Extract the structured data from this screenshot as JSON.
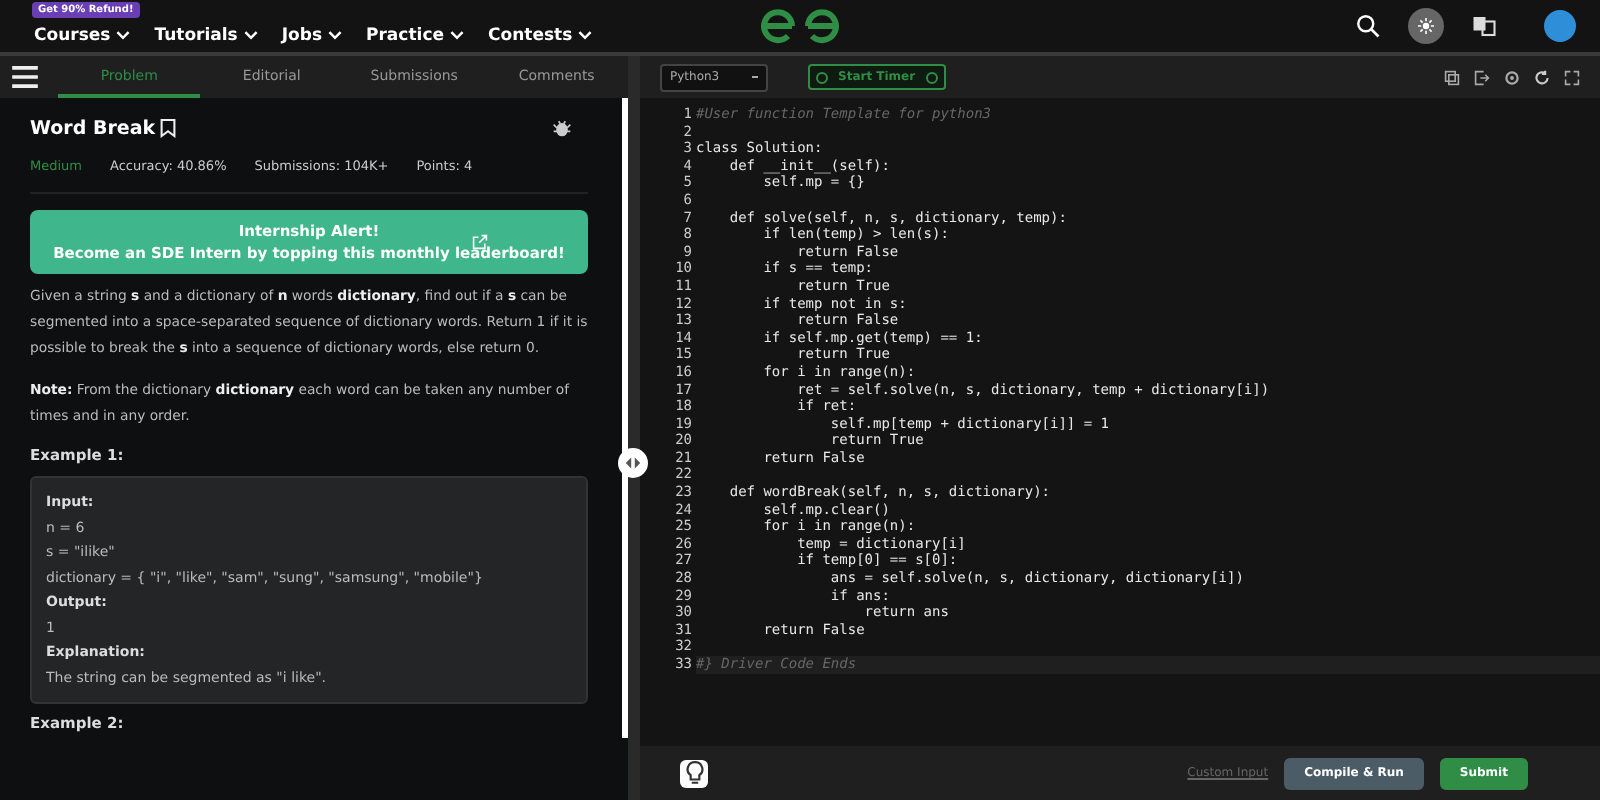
{
  "topnav": {
    "promo_badge": "Get 90% Refund!",
    "menus": [
      {
        "label": "Courses"
      },
      {
        "label": "Tutorials"
      },
      {
        "label": "Jobs"
      },
      {
        "label": "Practice"
      },
      {
        "label": "Contests"
      }
    ]
  },
  "left_tabs": [
    {
      "label": "Problem",
      "selected": true
    },
    {
      "label": "Editorial",
      "selected": false
    },
    {
      "label": "Submissions",
      "selected": false
    },
    {
      "label": "Comments",
      "selected": false
    }
  ],
  "problem": {
    "title": "Word Break",
    "difficulty": "Medium",
    "accuracy": "Accuracy: 40.86%",
    "submissions": "Submissions: 104K+",
    "points": "Points: 4",
    "banner": {
      "line1": "Internship Alert!",
      "line2": "Become an SDE Intern by topping this monthly leaderboard!"
    },
    "paragraphs": [
      "Given a string **s** and a dictionary of **n** words **dictionary**, find out if a **s** can be segmented into a space-separated sequence of dictionary words. Return 1 if it is possible to break the **s** into a sequence of dictionary words, else return 0.",
      "**Note:** From the dictionary **dictionary** each word can be taken any number of times and in any order."
    ],
    "example1": {
      "heading": "Example 1:",
      "lines": [
        {
          "kind": "label",
          "text": "Input:"
        },
        {
          "kind": "value",
          "text": "n = 6"
        },
        {
          "kind": "value",
          "text": "s = \"ilike\""
        },
        {
          "kind": "value",
          "text": "dictionary = { \"i\", \"like\", \"sam\", \"sung\", \"samsung\", \"mobile\"}"
        },
        {
          "kind": "label",
          "text": "Output:"
        },
        {
          "kind": "value",
          "text": "1"
        },
        {
          "kind": "label",
          "text": "Explanation:"
        },
        {
          "kind": "value",
          "text": "The string can be segmented as \"i like\"."
        }
      ]
    },
    "example2_heading": "Example 2:"
  },
  "editor": {
    "language": "Python3",
    "timer_button": "Start Timer",
    "lines": [
      {
        "kind": "comment",
        "text": "#User function Template for python3"
      },
      {
        "kind": "blank"
      },
      {
        "kind": "code",
        "text": "class Solution:"
      },
      {
        "kind": "code",
        "text": "    def __init__(self):"
      },
      {
        "kind": "code",
        "text": "        self.mp = {}"
      },
      {
        "kind": "blank"
      },
      {
        "kind": "code",
        "text": "    def solve(self, n, s, dictionary, temp):"
      },
      {
        "kind": "code",
        "text": "        if len(temp) > len(s):"
      },
      {
        "kind": "code",
        "text": "            return False"
      },
      {
        "kind": "code",
        "text": "        if s == temp:"
      },
      {
        "kind": "code",
        "text": "            return True"
      },
      {
        "kind": "code",
        "text": "        if temp not in s:"
      },
      {
        "kind": "code",
        "text": "            return False"
      },
      {
        "kind": "code",
        "text": "        if self.mp.get(temp) == 1:"
      },
      {
        "kind": "code",
        "text": "            return True"
      },
      {
        "kind": "code",
        "text": "        for i in range(n):"
      },
      {
        "kind": "code",
        "text": "            ret = self.solve(n, s, dictionary, temp + dictionary[i])"
      },
      {
        "kind": "code",
        "text": "            if ret:"
      },
      {
        "kind": "code",
        "text": "                self.mp[temp + dictionary[i]] = 1"
      },
      {
        "kind": "code",
        "text": "                return True"
      },
      {
        "kind": "code",
        "text": "        return False"
      },
      {
        "kind": "blank"
      },
      {
        "kind": "code",
        "text": "    def wordBreak(self, n, s, dictionary):"
      },
      {
        "kind": "code",
        "text": "        self.mp.clear()"
      },
      {
        "kind": "code",
        "text": "        for i in range(n):"
      },
      {
        "kind": "code",
        "text": "            temp = dictionary[i]"
      },
      {
        "kind": "code",
        "text": "            if temp[0] == s[0]:"
      },
      {
        "kind": "code",
        "text": "                ans = self.solve(n, s, dictionary, dictionary[i])"
      },
      {
        "kind": "code",
        "text": "                if ans:"
      },
      {
        "kind": "code",
        "text": "                    return ans"
      },
      {
        "kind": "code",
        "text": "        return False"
      },
      {
        "kind": "blank"
      },
      {
        "kind": "comment",
        "text": "#} Driver Code Ends"
      }
    ],
    "line_numbers": [
      "1",
      "2",
      "3",
      "4",
      "5",
      "6",
      "7",
      "8",
      "9",
      "10",
      "11",
      "12",
      "13",
      "14",
      "15",
      "16",
      "17",
      "18",
      "19",
      "20",
      "21",
      "22",
      "23",
      "24",
      "25",
      "26",
      "27",
      "28",
      "29",
      "30",
      "31",
      "32",
      "33"
    ],
    "custom_input": "Custom Input",
    "compile_button": "Compile & Run",
    "submit_button": "Submit"
  }
}
